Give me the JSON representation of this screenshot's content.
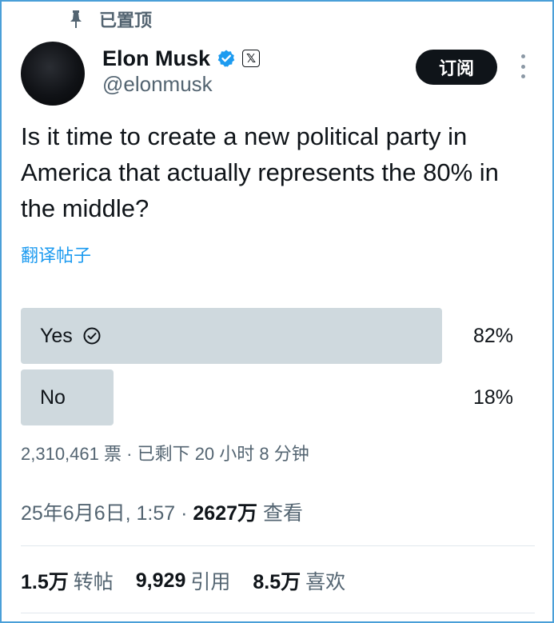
{
  "pinned": {
    "label": "已置顶",
    "icon": "pin-icon"
  },
  "author": {
    "name": "Elon Musk",
    "handle": "@elonmusk",
    "verified_icon": "verified-badge-icon",
    "affiliate_icon": "x-logo-icon",
    "badge_color": "#1d9bf0"
  },
  "actions": {
    "subscribe_label": "订阅",
    "more_icon": "more-vertical-icon"
  },
  "tweet": {
    "text": "Is it time to create a new political party in America that actually represents the 80% in the middle?",
    "translate_label": "翻译帖子"
  },
  "poll": {
    "options": [
      {
        "label": "Yes",
        "percent_text": "82%",
        "percent": 82,
        "winner": true
      },
      {
        "label": "No",
        "percent_text": "18%",
        "percent": 18,
        "winner": false
      }
    ],
    "votes_text": "2,310,461 票",
    "separator": "·",
    "time_left": "已剩下 20 小时 8 分钟"
  },
  "meta": {
    "date_time": "25年6月6日, 1:57",
    "separator": "·",
    "views_value": "2627万",
    "views_label": "查看"
  },
  "stats": [
    {
      "value": "1.5万",
      "label": "转帖"
    },
    {
      "value": "9,929",
      "label": "引用"
    },
    {
      "value": "8.5万",
      "label": "喜欢"
    }
  ],
  "colors": {
    "accent": "#1d9bf0",
    "text": "#0f1419",
    "secondary_text": "#536471",
    "poll_bar": "#cfd9de",
    "frame_border": "#4a9fd8"
  }
}
